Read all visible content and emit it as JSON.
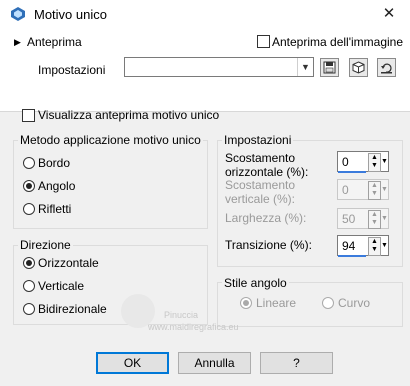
{
  "window": {
    "title": "Motivo unico",
    "close_glyph": "✕"
  },
  "preview": {
    "label": "Anteprima",
    "image_preview_label": "Anteprima dell'immagine",
    "image_preview_checked": false
  },
  "settings": {
    "label": "Impostazioni",
    "value": ""
  },
  "show_preview": {
    "label": "Visualizza anteprima motivo unico",
    "checked": false
  },
  "method": {
    "title": "Metodo applicazione motivo unico",
    "options": [
      {
        "label": "Bordo"
      },
      {
        "label": "Angolo"
      },
      {
        "label": "Rifletti"
      }
    ],
    "selected": "Angolo"
  },
  "direction": {
    "title": "Direzione",
    "options": [
      {
        "label": "Orizzontale"
      },
      {
        "label": "Verticale"
      },
      {
        "label": "Bidirezionale"
      }
    ],
    "selected": "Orizzontale"
  },
  "settings_group": {
    "title": "Impostazioni",
    "h_offset": {
      "label1": "Scostamento",
      "label2": "orizzontale (%):",
      "value": "0"
    },
    "v_offset": {
      "label1": "Scostamento",
      "label2": "verticale (%):",
      "value": "0"
    },
    "width": {
      "label": "Larghezza (%):",
      "value": "50"
    },
    "transition": {
      "label": "Transizione (%):",
      "value": "94"
    }
  },
  "corner_style": {
    "title": "Stile angolo",
    "linear": "Lineare",
    "curve": "Curvo",
    "selected": "Lineare"
  },
  "watermark": {
    "line1": "Pinuccia",
    "line2": "www.maidiregrafica.eu"
  },
  "buttons": {
    "ok": "OK",
    "cancel": "Annulla",
    "help": "?"
  },
  "colors": {
    "accent": "#0078d7",
    "spin_bar": "#3b7bdc"
  }
}
